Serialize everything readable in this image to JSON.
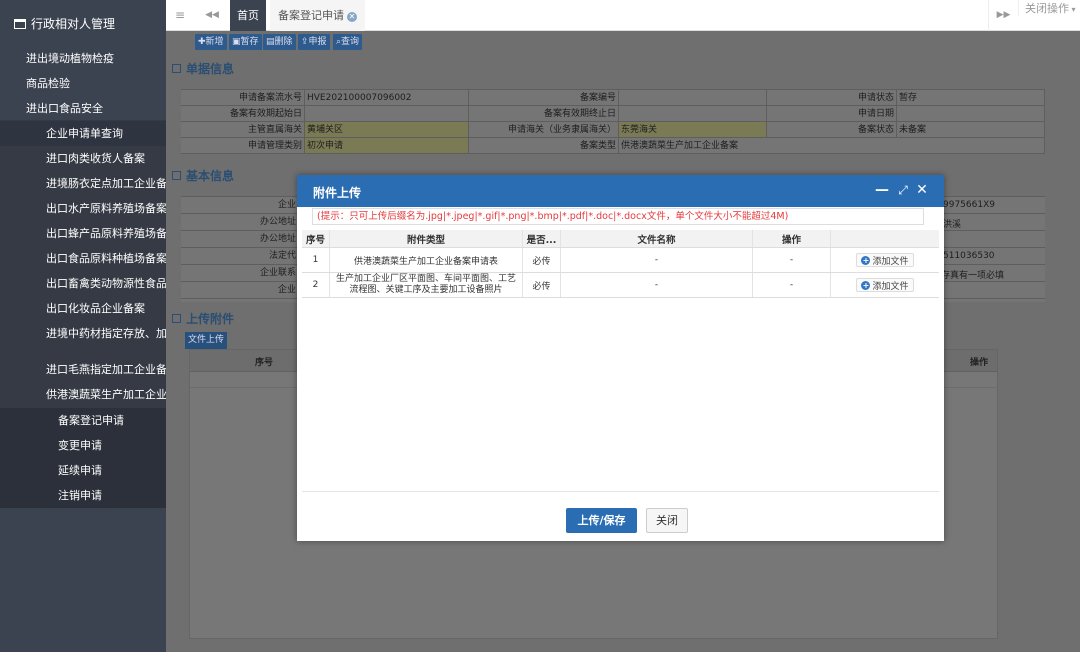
{
  "sidebar": {
    "title": "行政相对人管理",
    "items": [
      {
        "label": "进出境动植物检疫",
        "level": 1
      },
      {
        "label": "商品检验",
        "level": 1
      },
      {
        "label": "进出口食品安全",
        "level": 1
      },
      {
        "label": "企业申请单查询",
        "level": 2
      },
      {
        "label": "进口肉类收货人备案",
        "level": 2
      },
      {
        "label": "进境肠衣定点加工企业备案",
        "level": 2
      },
      {
        "label": "出口水产原料养殖场备案",
        "level": 2
      },
      {
        "label": "出口蜂产品原料养殖场备案",
        "level": 2
      },
      {
        "label": "出口食品原料种植场备案",
        "level": 2
      },
      {
        "label": "出口畜禽类动物源性食品备案",
        "level": 2
      },
      {
        "label": "出口化妆品企业备案",
        "level": 2
      },
      {
        "label": "进境中药材指定存放、加工企业备案",
        "level": 2
      },
      {
        "label": "进口毛燕指定加工企业备案",
        "level": 2
      },
      {
        "label": "供港澳蔬菜生产加工企业备案",
        "level": 2
      },
      {
        "label": "备案登记申请",
        "level": 3
      },
      {
        "label": "变更申请",
        "level": 3
      },
      {
        "label": "延续申请",
        "level": 3
      },
      {
        "label": "注销申请",
        "level": 3
      }
    ]
  },
  "tabbar": {
    "menu_icon": "≡",
    "back_icon": "◀◀",
    "home": "首页",
    "current_tab": "备案登记申请",
    "forward_icon": "▶▶",
    "close_ops": "关闭操作"
  },
  "toolbar": {
    "new": "新增",
    "save_draft": "暂存",
    "delete": "删除",
    "declare": "申报",
    "query": "查询"
  },
  "sections": {
    "doc_info": "单据信息",
    "basic_info": "基本信息",
    "upload": "上传附件"
  },
  "doc_info": {
    "rows": [
      [
        "申请备案流水号",
        "HVE202100007096002",
        "备案编号",
        "",
        "申请状态",
        "暂存"
      ],
      [
        "备案有效期起始日",
        "",
        "备案有效期终止日",
        "",
        "申请日期",
        ""
      ],
      [
        "主管直属海关",
        "黄埔关区",
        "申请海关（业务隶属海关）",
        "东莞海关",
        "备案状态",
        "未备案"
      ],
      [
        "申请管理类别",
        "初次申请",
        "备案类型",
        "供港澳蔬菜生产加工企业备案",
        "",
        ""
      ]
    ]
  },
  "basic_info": {
    "labels": [
      "企业",
      "办公地址",
      "办公地址",
      "法定代",
      "企业联系",
      "企业"
    ],
    "partial_values": [
      "9975661X9",
      "洪溪",
      "511036530",
      "存真有一项必填"
    ]
  },
  "upload": {
    "upload_button": "文件上传",
    "col_seq": "序号",
    "col_ops": "操作"
  },
  "dialog": {
    "title": "附件上传",
    "hint": "(提示：只可上传后缀名为.jpg|*.jpeg|*.gif|*.png|*.bmp|*.pdf|*.doc|*.docx文件，单个文件大小不能超过4M)",
    "columns": [
      "序号",
      "附件类型",
      "是否...",
      "文件名称",
      "操作"
    ],
    "rows": [
      {
        "seq": "1",
        "type": "供港澳蔬菜生产加工企业备案申请表",
        "required": "必传",
        "filename": "-",
        "op": "-",
        "action": "添加文件"
      },
      {
        "seq": "2",
        "type": "生产加工企业厂区平面图、车间平面图、工艺流程图、关键工序及主要加工设备照片",
        "required": "必传",
        "filename": "-",
        "op": "-",
        "action": "添加文件"
      }
    ],
    "ok": "上传/保存",
    "close": "关闭"
  },
  "colors": {
    "sidebar_bg": "#3c4350",
    "dialog_header": "#2a6db3",
    "hint_text": "#e4393c"
  }
}
